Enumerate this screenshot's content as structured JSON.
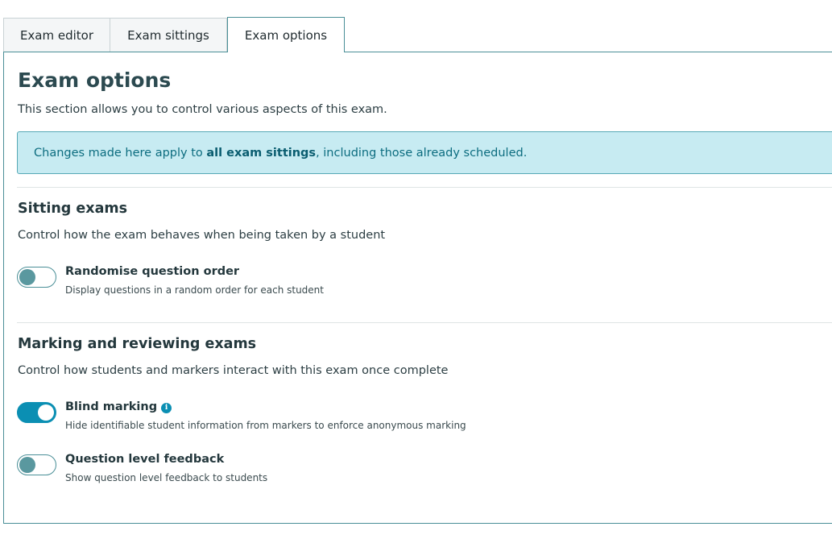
{
  "tabs": [
    {
      "label": "Exam editor"
    },
    {
      "label": "Exam sittings"
    },
    {
      "label": "Exam options"
    }
  ],
  "page": {
    "title": "Exam options",
    "intro": "This section allows you to control various aspects of this exam."
  },
  "alert": {
    "before": "Changes made here apply to ",
    "strong": "all exam sittings",
    "after": ", including those already scheduled."
  },
  "sections": [
    {
      "title": "Sitting exams",
      "description": "Control how the exam behaves when being taken by a student",
      "options": [
        {
          "label": "Randomise question order",
          "help": "Display questions in a random order for each student",
          "enabled": false
        }
      ]
    },
    {
      "title": "Marking and reviewing exams",
      "description": "Control how students and markers interact with this exam once complete",
      "options": [
        {
          "label": "Blind marking",
          "help": "Hide identifiable student information from markers to enforce anonymous marking",
          "enabled": true,
          "info_icon": "info-icon",
          "info_glyph": "i"
        },
        {
          "label": "Question level feedback",
          "help": "Show question level feedback to students",
          "enabled": false
        }
      ]
    }
  ],
  "colors": {
    "accent": "#0b8fb3",
    "border": "#4a8f97",
    "alert_bg": "#c7ebf2",
    "alert_text": "#0d6d80"
  }
}
